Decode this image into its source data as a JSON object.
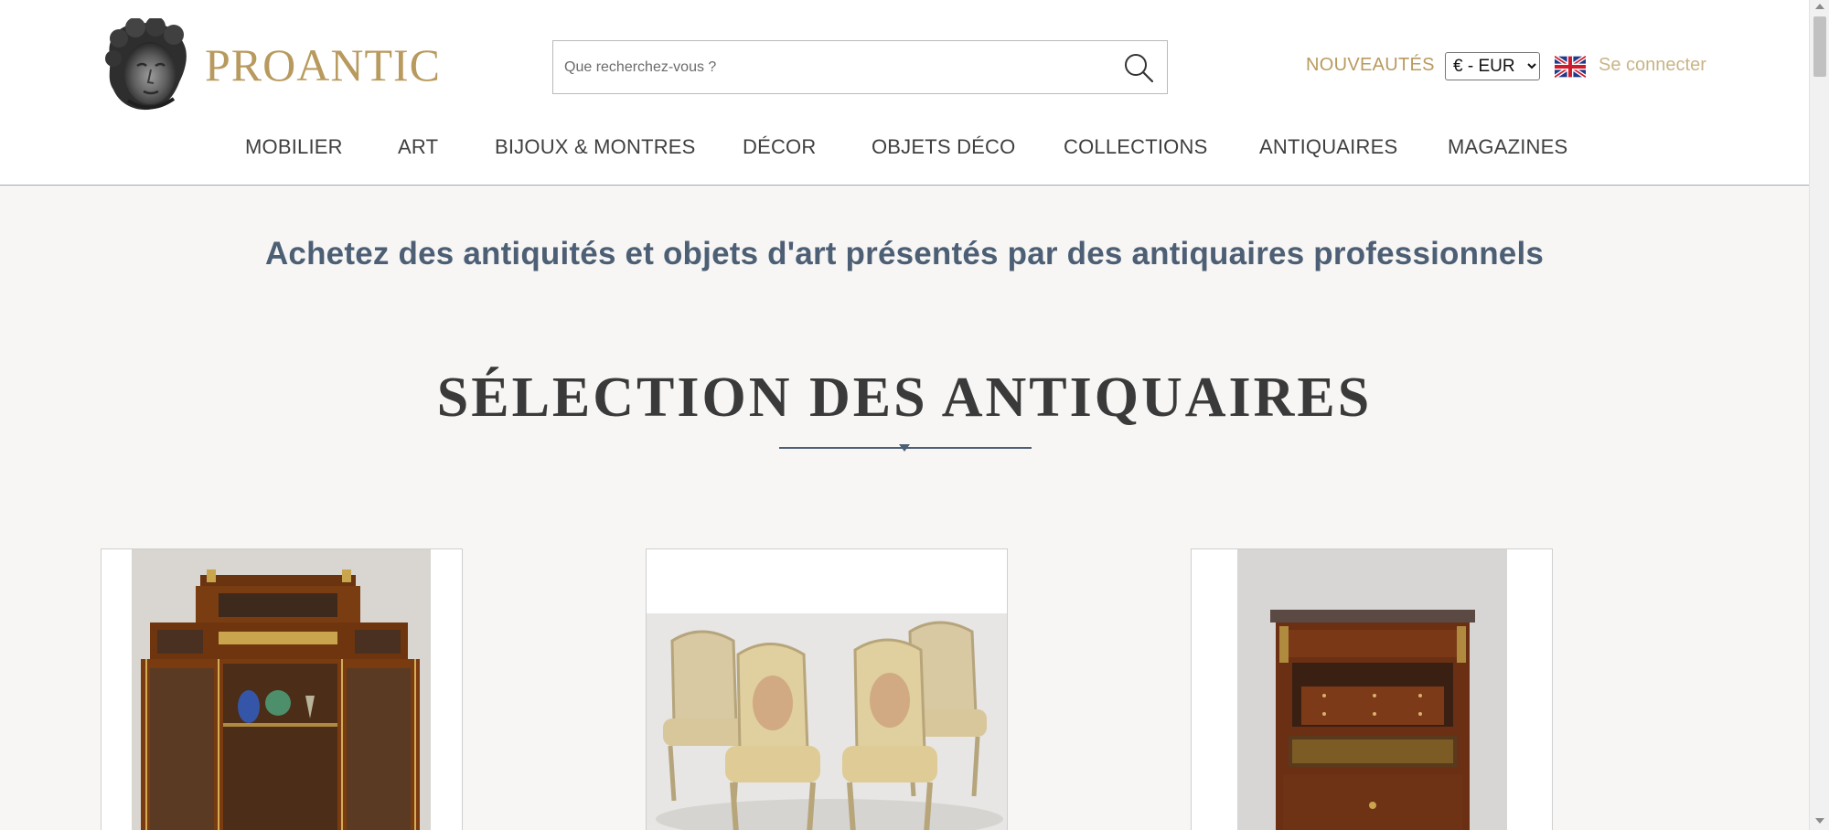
{
  "header": {
    "logo_text": "PROANTIC",
    "logo_icon": "classical-head-logo",
    "search": {
      "placeholder": "Que recherchez-vous ?",
      "value": "",
      "icon": "search-icon"
    },
    "new_items_label": "NOUVEAUTÉS",
    "currency": {
      "selected": "€ - EUR",
      "options": [
        "€ - EUR"
      ]
    },
    "language_flag": "uk-flag-icon",
    "login_label": "Se connecter"
  },
  "nav": {
    "items": [
      {
        "label": "MOBILIER"
      },
      {
        "label": "ART"
      },
      {
        "label": "BIJOUX & MONTRES"
      },
      {
        "label": "DÉCOR"
      },
      {
        "label": "OBJETS DÉCO"
      },
      {
        "label": "COLLECTIONS"
      },
      {
        "label": "ANTIQUAIRES"
      },
      {
        "label": "MAGAZINES"
      }
    ]
  },
  "main": {
    "tagline": "Achetez des antiquités et objets d'art présentés par des antiquaires professionnels",
    "section_title": "SÉLECTION DES ANTIQUAIRES",
    "cards": [
      {
        "image": "display-cabinet-photo"
      },
      {
        "image": "four-armchairs-photo"
      },
      {
        "image": "secretary-desk-photo"
      }
    ]
  },
  "colors": {
    "brand_gold": "#b89a5e",
    "login_gold": "#c9b487",
    "slate_blue": "#4d5f75",
    "page_background": "#f7f6f4",
    "header_background": "#ffffff"
  }
}
